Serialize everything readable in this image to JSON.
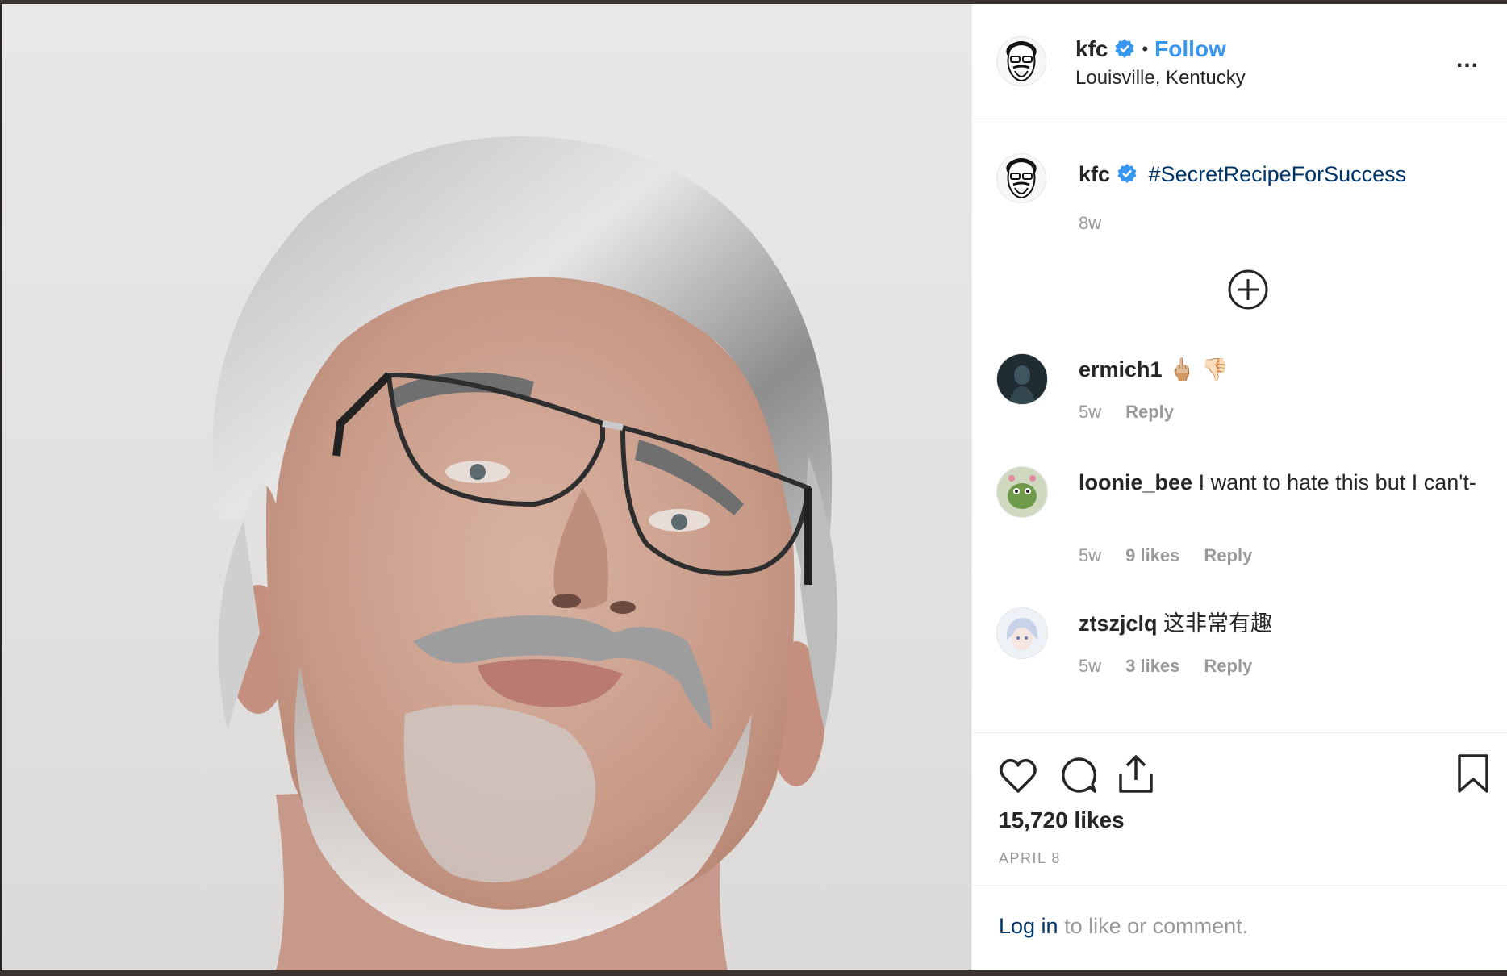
{
  "header": {
    "username": "kfc",
    "separator": "•",
    "follow_label": "Follow",
    "location": "Louisville, Kentucky",
    "more_label": "..."
  },
  "caption": {
    "username": "kfc",
    "text": "#SecretRecipeForSuccess",
    "time": "8w"
  },
  "comments": [
    {
      "username": "ermich1",
      "text": "🖕🏼 👎🏻",
      "time": "5w",
      "likes": "",
      "reply": "Reply"
    },
    {
      "username": "loonie_bee",
      "text": "I want to hate this but I can't-",
      "time": "5w",
      "likes": "9 likes",
      "reply": "Reply"
    },
    {
      "username": "ztszjclq",
      "text": "这非常有趣",
      "time": "5w",
      "likes": "3 likes",
      "reply": "Reply"
    }
  ],
  "actions": {
    "likes": "15,720 likes",
    "date": "APRIL 8"
  },
  "footer": {
    "login_link": "Log in",
    "login_rest": " to like or comment."
  },
  "colors": {
    "link_blue": "#3897f0",
    "hashtag_navy": "#003569",
    "muted_gray": "#999999",
    "text": "#262626"
  },
  "icons": [
    "verified-badge-icon",
    "more-options-icon",
    "load-more-comments-icon",
    "heart-icon",
    "comment-icon",
    "share-icon",
    "bookmark-icon"
  ]
}
